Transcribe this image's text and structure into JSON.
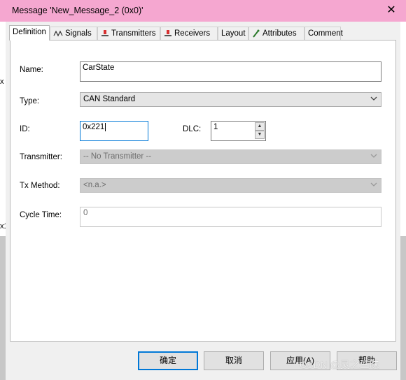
{
  "window": {
    "title": "Message 'New_Message_2 (0x0)'",
    "close_symbol": "✕",
    "background_fragments": [
      "x",
      "x1"
    ]
  },
  "tabs": [
    {
      "label": "Definition",
      "icon": "none",
      "active": true
    },
    {
      "label": "Signals",
      "icon": "signals-icon"
    },
    {
      "label": "Transmitters",
      "icon": "transmitter-icon"
    },
    {
      "label": "Receivers",
      "icon": "receiver-icon"
    },
    {
      "label": "Layout",
      "icon": "none"
    },
    {
      "label": "Attributes",
      "icon": "attributes-icon"
    },
    {
      "label": "Comment",
      "icon": "none"
    }
  ],
  "form": {
    "name_label": "Name:",
    "name_value": "CarState",
    "type_label": "Type:",
    "type_value": "CAN Standard",
    "id_label": "ID:",
    "id_value": "0x221",
    "dlc_label": "DLC:",
    "dlc_value": "1",
    "transmitter_label": "Transmitter:",
    "transmitter_value": "-- No Transmitter --",
    "txmethod_label": "Tx Method:",
    "txmethod_value": "<n.a.>",
    "cycletime_label": "Cycle Time:",
    "cycletime_value": "0"
  },
  "buttons": {
    "ok": "确定",
    "cancel": "取消",
    "apply": "应用(A)",
    "help": "帮助"
  },
  "watermark": "CSDN @灵之三昧",
  "colors": {
    "titlebar": "#f5a7d0",
    "focus_border": "#0078d7"
  }
}
